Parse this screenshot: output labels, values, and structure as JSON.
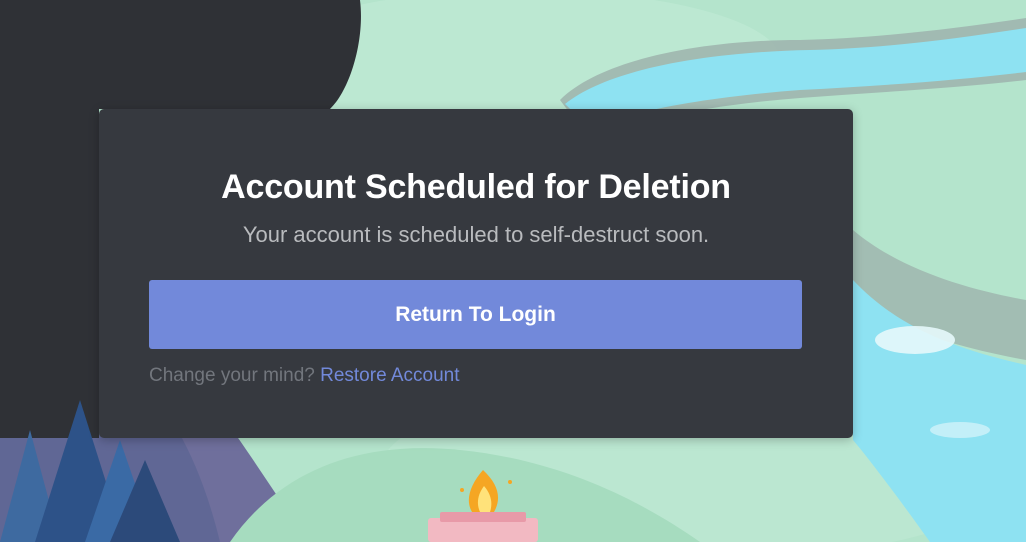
{
  "dialog": {
    "title": "Account Scheduled for Deletion",
    "subtitle": "Your account is scheduled to self-destruct soon.",
    "return_button_label": "Return To Login",
    "change_mind_prompt": "Change your mind?",
    "restore_link_label": "Restore Account"
  },
  "colors": {
    "background_mint": "#b4e4cc",
    "modal_bg": "#36393f",
    "accent_blurple": "#7289da",
    "title_text": "#ffffff",
    "subtitle_text": "#b9bbbe",
    "muted_text": "#72767d",
    "river_blue": "#8ee2f2"
  }
}
